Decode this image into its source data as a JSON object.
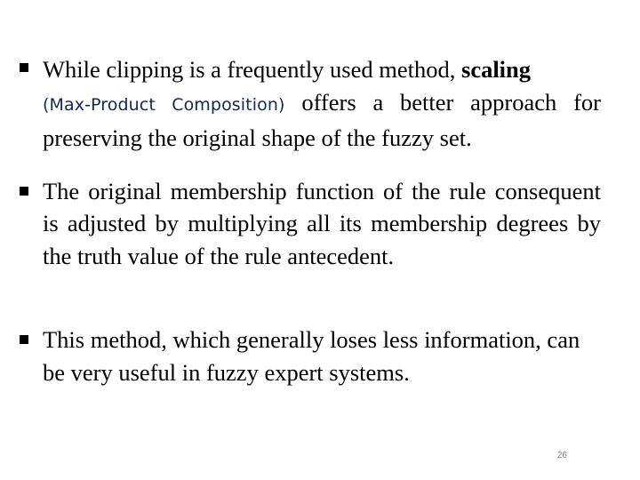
{
  "slide": {
    "bullets": [
      {
        "text_before": "While clipping is a frequently used method, ",
        "bold": "scaling",
        "newline_text_styled": "(Max-Product Composition)",
        "text_after": " offers a better approach for preserving the original shape of the fuzzy set."
      },
      {
        "text": "The original membership function of the rule consequent is adjusted by multiplying all its membership degrees by the truth value of the rule antecedent."
      },
      {
        "text": "This method, which generally loses less information, can be very useful in fuzzy expert systems."
      }
    ],
    "page_number": "26",
    "colors": {
      "text": "#000000",
      "highlight_text": "#0e2a55",
      "page_number": "#808080",
      "background": "#ffffff"
    }
  }
}
